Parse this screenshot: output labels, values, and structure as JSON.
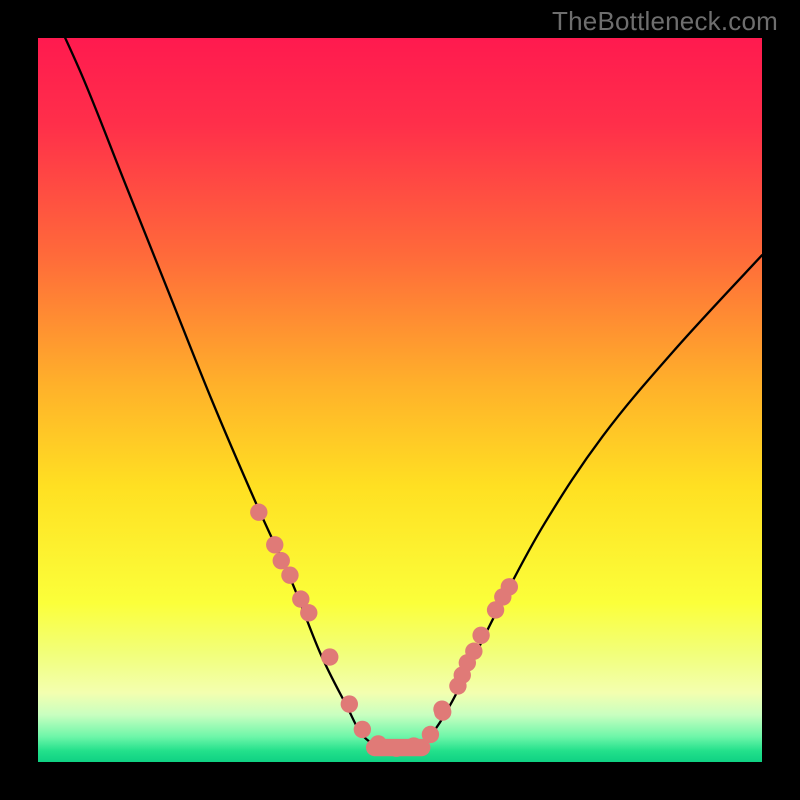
{
  "watermark": "TheBottleneck.com",
  "colors": {
    "frame": "#000000",
    "curve": "#000000",
    "marker_fill": "#e07a77",
    "gradient_stops": [
      {
        "offset": 0.0,
        "color": "#ff1a4f"
      },
      {
        "offset": 0.12,
        "color": "#ff2f4a"
      },
      {
        "offset": 0.3,
        "color": "#ff6a3a"
      },
      {
        "offset": 0.48,
        "color": "#ffb12a"
      },
      {
        "offset": 0.62,
        "color": "#ffe022"
      },
      {
        "offset": 0.78,
        "color": "#fbff3a"
      },
      {
        "offset": 0.85,
        "color": "#f2ff7a"
      },
      {
        "offset": 0.905,
        "color": "#f3ffb0"
      },
      {
        "offset": 0.935,
        "color": "#c8ffc0"
      },
      {
        "offset": 0.965,
        "color": "#6ef6a9"
      },
      {
        "offset": 0.985,
        "color": "#22e08b"
      },
      {
        "offset": 1.0,
        "color": "#0fd183"
      }
    ]
  },
  "chart_data": {
    "type": "line",
    "title": "",
    "xlabel": "",
    "ylabel": "",
    "xlim": [
      0,
      100
    ],
    "ylim": [
      0,
      100
    ],
    "grid": false,
    "legend": false,
    "series": [
      {
        "name": "bottleneck-curve",
        "x": [
          0,
          6,
          12,
          18,
          24,
          30,
          35,
          39,
          42.5,
          45,
          48,
          51,
          54,
          57,
          60,
          64,
          70,
          78,
          88,
          100
        ],
        "y": [
          108,
          95,
          80,
          65,
          50,
          36,
          25,
          15,
          8,
          3.5,
          2,
          2,
          3.5,
          8,
          14,
          22,
          33,
          45,
          57,
          70
        ]
      }
    ],
    "markers": {
      "name": "data-points",
      "x": [
        30.5,
        32.7,
        33.6,
        34.8,
        36.3,
        37.4,
        40.3,
        43.0,
        44.8,
        47.0,
        49.5,
        51.9,
        54.2,
        55.8,
        55.9,
        58.0,
        58.6,
        59.3,
        60.2,
        61.2,
        63.2,
        64.2,
        65.1
      ],
      "y": [
        34.5,
        30.0,
        27.8,
        25.8,
        22.5,
        20.6,
        14.5,
        8.0,
        4.5,
        2.5,
        1.9,
        2.2,
        3.8,
        7.3,
        6.9,
        10.5,
        12.0,
        13.7,
        15.3,
        17.5,
        21.0,
        22.8,
        24.2
      ],
      "radius": 1.2
    }
  }
}
